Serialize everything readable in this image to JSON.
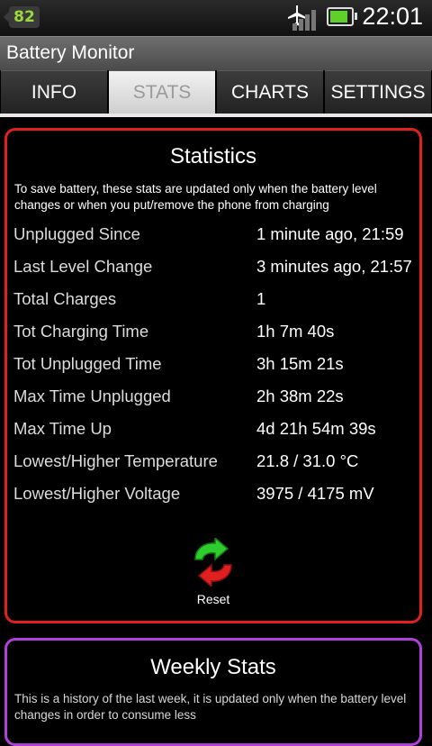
{
  "status_bar": {
    "badge": "82",
    "time": "22:01",
    "icons": [
      "airplane-mode-icon",
      "signal-icon",
      "battery-icon"
    ],
    "battery_level": 0.85
  },
  "app": {
    "title": "Battery Monitor"
  },
  "tabs": [
    {
      "label": "INFO",
      "active": false
    },
    {
      "label": "STATS",
      "active": true
    },
    {
      "label": "CHARTS",
      "active": false
    },
    {
      "label": "SETTINGS",
      "active": false
    }
  ],
  "statistics": {
    "title": "Statistics",
    "note": "To save battery, these stats are updated only when the battery level changes or when you put/remove the phone from charging",
    "rows": [
      {
        "label": "Unplugged Since",
        "value": "1 minute ago, 21:59"
      },
      {
        "label": "Last Level Change",
        "value": "3 minutes ago, 21:57"
      },
      {
        "label": "Total Charges",
        "value": "1"
      },
      {
        "label": "Tot Charging Time",
        "value": "1h 7m 40s"
      },
      {
        "label": "Tot Unplugged Time",
        "value": "3h 15m 21s"
      },
      {
        "label": "Max Time Unplugged",
        "value": "2h 38m 22s"
      },
      {
        "label": "Max Time Up",
        "value": "4d 21h 54m 39s"
      },
      {
        "label": "Lowest/Higher Temperature",
        "value": "21.8 / 31.0 °C"
      },
      {
        "label": "Lowest/Higher Voltage",
        "value": "3975 / 4175 mV"
      }
    ],
    "reset_label": "Reset",
    "colors": {
      "border": "#e21f1f",
      "reset_green": "#2ecc2e",
      "reset_red": "#e02020"
    }
  },
  "weekly": {
    "title": "Weekly Stats",
    "note": "This is a history of the last week, it is updated only when the battery level changes in order to consume less",
    "colors": {
      "border": "#b040d8"
    }
  }
}
